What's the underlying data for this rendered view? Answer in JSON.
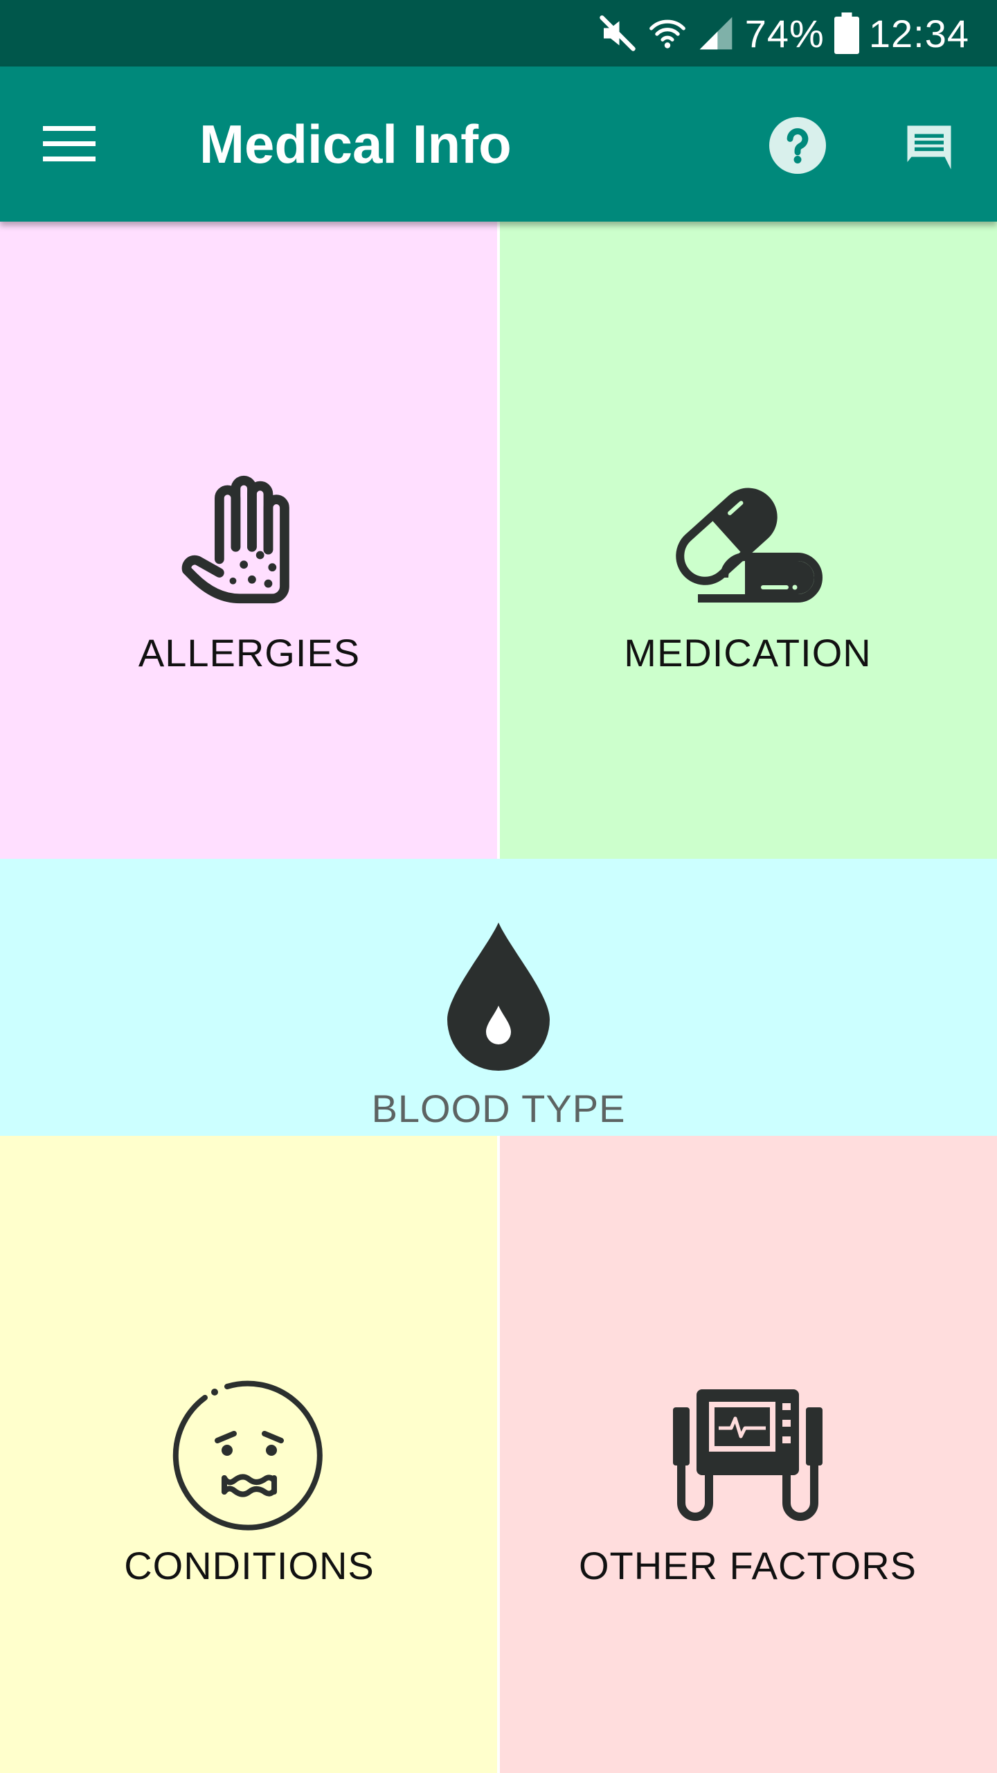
{
  "status_bar": {
    "battery": "74%",
    "time": "12:34",
    "icons": [
      "mute-icon",
      "wifi-icon",
      "signal-icon",
      "battery-icon"
    ]
  },
  "app_bar": {
    "title": "Medical Info",
    "menu_icon": "hamburger-menu-icon",
    "help_icon": "help-icon",
    "chat_icon": "chat-icon"
  },
  "tiles": {
    "allergies": {
      "label": "ALLERGIES",
      "icon": "hand-rash-icon",
      "color": "#ffdfff"
    },
    "medication": {
      "label": "MEDICATION",
      "icon": "pills-icon",
      "color": "#ccffcc"
    },
    "blood_type": {
      "label": "BLOOD TYPE",
      "icon": "blood-drop-icon",
      "color": "#ccffff"
    },
    "conditions": {
      "label": "CONDITIONS",
      "icon": "sick-face-icon",
      "color": "#ffffcc"
    },
    "other_factors": {
      "label": "OTHER FACTORS",
      "icon": "defibrillator-icon",
      "color": "#ffdddd"
    }
  },
  "colors": {
    "status_bar": "#00574b",
    "app_bar": "#00897b",
    "icon_dark": "#2b2f2e"
  }
}
